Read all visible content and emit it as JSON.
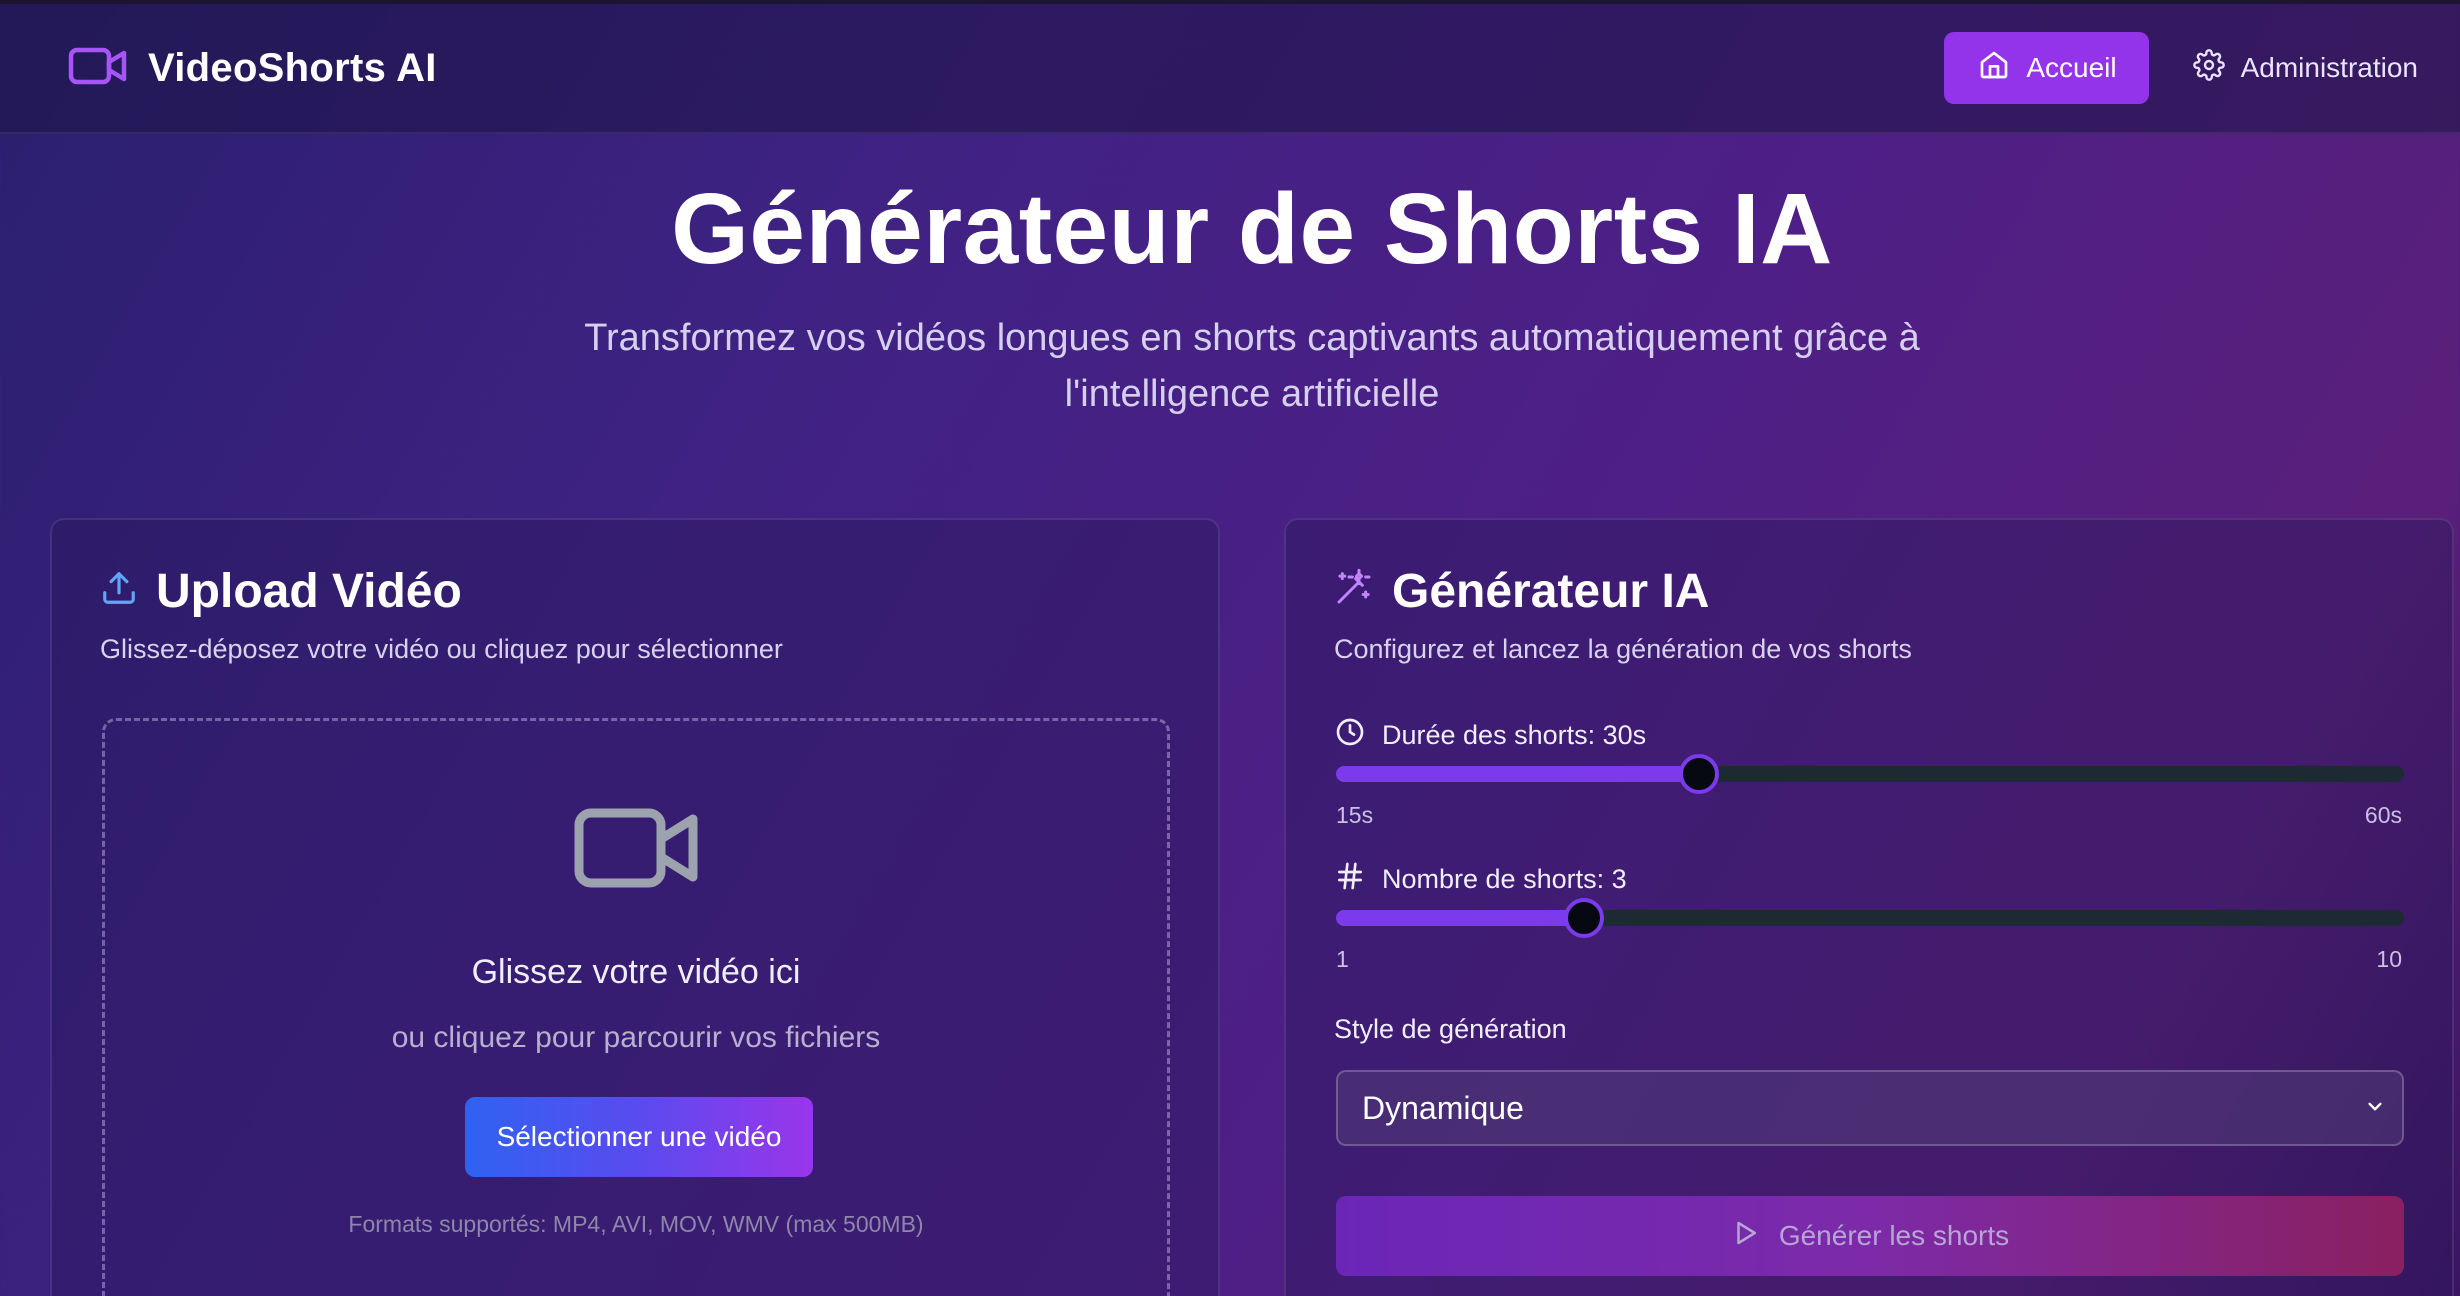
{
  "navbar": {
    "brand": "VideoShorts AI",
    "brand_icon": "video-camera-icon",
    "home_label": "Accueil",
    "admin_label": "Administration"
  },
  "hero": {
    "title": "Générateur de Shorts IA",
    "subtitle": "Transformez vos vidéos longues en shorts captivants automatiquement grâce à l'intelligence artificielle"
  },
  "upload": {
    "title": "Upload Vidéo",
    "description": "Glissez-déposez votre vidéo ou cliquez pour sélectionner",
    "drop_title": "Glissez votre vidéo ici",
    "drop_sub": "ou cliquez pour parcourir vos fichiers",
    "button": "Sélectionner une vidéo",
    "formats": "Formats supportés: MP4, AVI, MOV, WMV (max 500MB)"
  },
  "generator": {
    "title": "Générateur IA",
    "description": "Configurez et lancez la génération de vos shorts",
    "duration": {
      "label": "Durée des shorts: 30s",
      "min_label": "15s",
      "max_label": "60s",
      "min": 15,
      "max": 60,
      "value": 30
    },
    "count": {
      "label": "Nombre de shorts: 3",
      "min_label": "1",
      "max_label": "10",
      "min": 1,
      "max": 10,
      "value": 3
    },
    "style_label": "Style de génération",
    "style_value": "Dynamique",
    "generate_button": "Générer les shorts"
  },
  "colors": {
    "accent": "#9333ea",
    "slider": "#7c3aed"
  }
}
